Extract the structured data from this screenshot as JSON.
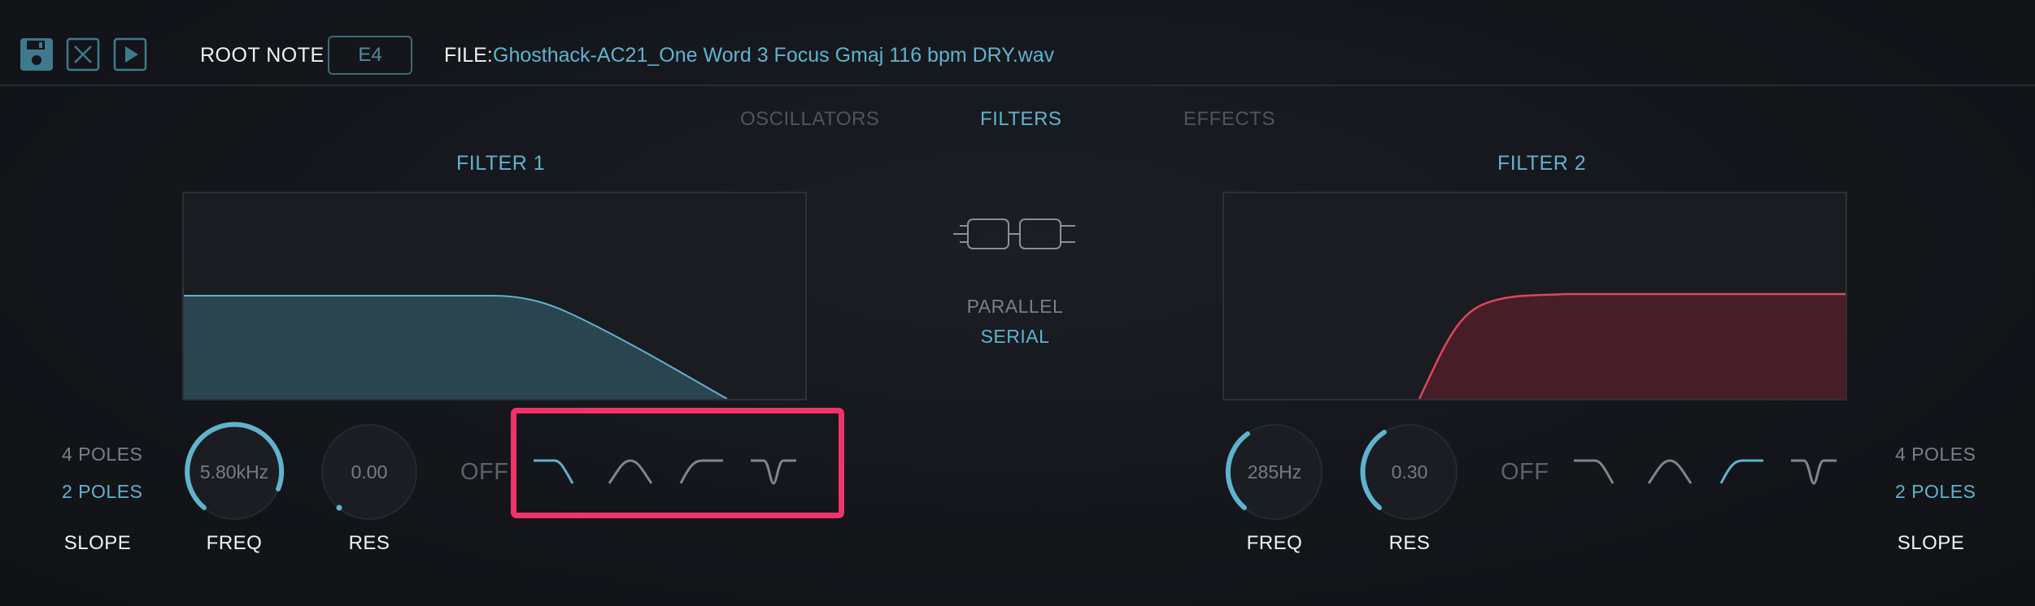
{
  "toolbar": {
    "save_icon": "save-icon",
    "close_icon": "close-icon",
    "play_icon": "play-icon",
    "root_note_label": "ROOT NOTE",
    "root_note_value": "E4",
    "file_label": "FILE:",
    "file_name": "Ghosthack-AC21_One Word 3 Focus Gmaj 116 bpm DRY.wav"
  },
  "tabs": [
    {
      "label": "OSCILLATORS",
      "active": false
    },
    {
      "label": "FILTERS",
      "active": true
    },
    {
      "label": "EFFECTS",
      "active": false
    }
  ],
  "routing": {
    "icon": "filter-routing-icon",
    "options": [
      {
        "label": "PARALLEL",
        "selected": false
      },
      {
        "label": "SERIAL",
        "selected": true
      }
    ]
  },
  "filter1": {
    "title": "FILTER 1",
    "slope_options": [
      {
        "label": "4 POLES",
        "selected": false
      },
      {
        "label": "2 POLES",
        "selected": true
      }
    ],
    "slope_label": "SLOPE",
    "freq": {
      "value": "5.80kHz",
      "label": "FREQ",
      "level": 0.72
    },
    "res": {
      "value": "0.00",
      "label": "RES",
      "level": 0.0
    },
    "off_label": "OFF",
    "types": [
      {
        "icon": "lowpass-icon",
        "selected": true
      },
      {
        "icon": "bandpass-icon",
        "selected": false
      },
      {
        "icon": "highpass-icon",
        "selected": false
      },
      {
        "icon": "notch-icon",
        "selected": false
      }
    ],
    "curve_color": "#5fb3cf"
  },
  "filter2": {
    "title": "FILTER 2",
    "slope_options": [
      {
        "label": "4 POLES",
        "selected": false
      },
      {
        "label": "2 POLES",
        "selected": true
      }
    ],
    "slope_label": "SLOPE",
    "freq": {
      "value": "285Hz",
      "label": "FREQ",
      "level": 0.3
    },
    "res": {
      "value": "0.30",
      "label": "RES",
      "level": 0.3
    },
    "off_label": "OFF",
    "types": [
      {
        "icon": "lowpass-icon",
        "selected": false
      },
      {
        "icon": "bandpass-icon",
        "selected": false
      },
      {
        "icon": "highpass-icon",
        "selected": true
      },
      {
        "icon": "notch-icon",
        "selected": false
      }
    ],
    "curve_color": "#e0475a"
  },
  "colors": {
    "accent": "#5fb3cf",
    "dim_text": "#50545c",
    "highlight": "#f0336a"
  }
}
